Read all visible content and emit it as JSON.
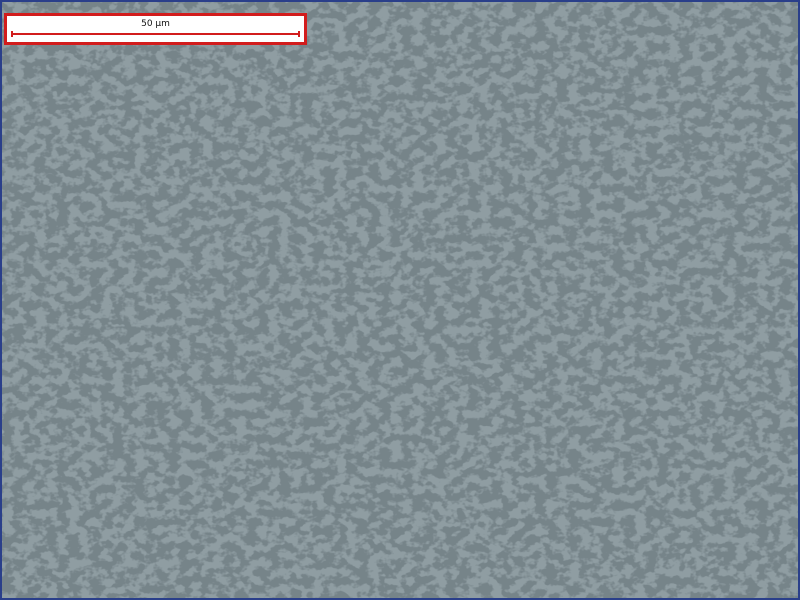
{
  "image": {
    "subject": "metallographic-micrograph",
    "colors": {
      "matrix": "#8f9da2",
      "dark_phase": "#2f3b40",
      "tan_phase": "#a39887",
      "border": "#2a3f8a"
    }
  },
  "scale_bar": {
    "label": "50 µm",
    "color": "#d21c1c",
    "background": "#ffffff"
  }
}
